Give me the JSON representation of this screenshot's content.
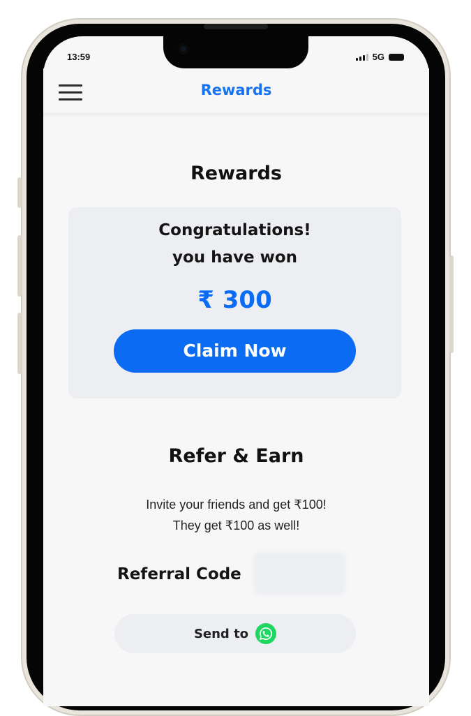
{
  "status_bar": {
    "time": "13:59",
    "network": "5G"
  },
  "app_bar": {
    "title": "Rewards",
    "menu_icon": "hamburger-menu-icon"
  },
  "rewards": {
    "heading": "Rewards",
    "congrats_line1": "Congratulations!",
    "congrats_line2": "you have won",
    "amount": "₹ 300",
    "claim_label": "Claim Now"
  },
  "refer": {
    "heading": "Refer & Earn",
    "invite_line1": "Invite your friends and get ₹100!",
    "invite_line2": "They get ₹100 as well!",
    "code_label": "Referral Code",
    "code_value": "",
    "send_label": "Send to",
    "send_icon": "whatsapp-icon"
  },
  "colors": {
    "accent": "#0b6cf3",
    "title_blue": "#1873f0",
    "card_bg": "#eceef1",
    "whatsapp": "#1ed760"
  }
}
